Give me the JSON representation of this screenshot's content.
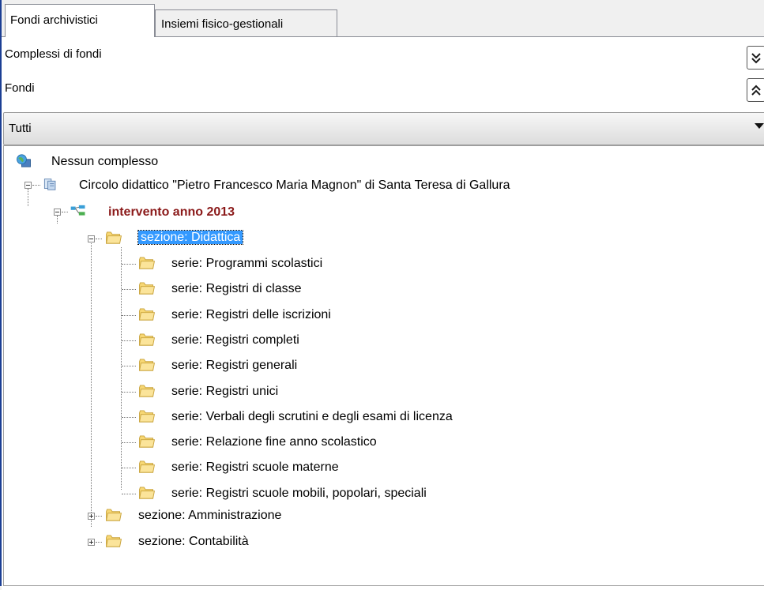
{
  "tabs": [
    {
      "label": "Fondi archivistici",
      "active": true
    },
    {
      "label": "Insiemi fisico-gestionali",
      "active": false
    }
  ],
  "filters": {
    "complessi_label": "Complessi di fondi",
    "fondi_label": "Fondi",
    "dropdown_value": "Tutti"
  },
  "tree": {
    "root": "Nessun complesso",
    "fondo": "Circolo didattico \"Pietro Francesco Maria Magnon\" di Santa Teresa di Gallura",
    "intervento": "intervento anno 2013",
    "sezione_didattica": "sezione: Didattica",
    "serie": [
      "serie: Programmi scolastici",
      "serie: Registri di classe",
      "serie: Registri delle iscrizioni",
      "serie: Registri completi",
      "serie: Registri generali",
      "serie: Registri unici",
      "serie: Verbali degli scrutini e degli esami di licenza",
      "serie: Relazione fine anno scolastico",
      "serie: Registri scuole materne",
      "serie: Registri scuole mobili, popolari, speciali"
    ],
    "sezione_amministrazione": "sezione: Amministrazione",
    "sezione_contabilita": "sezione: Contabilità"
  },
  "colors": {
    "selection": "#3399ff",
    "intervento_text": "#8b1a1a",
    "frame_border": "#1c3f94"
  }
}
